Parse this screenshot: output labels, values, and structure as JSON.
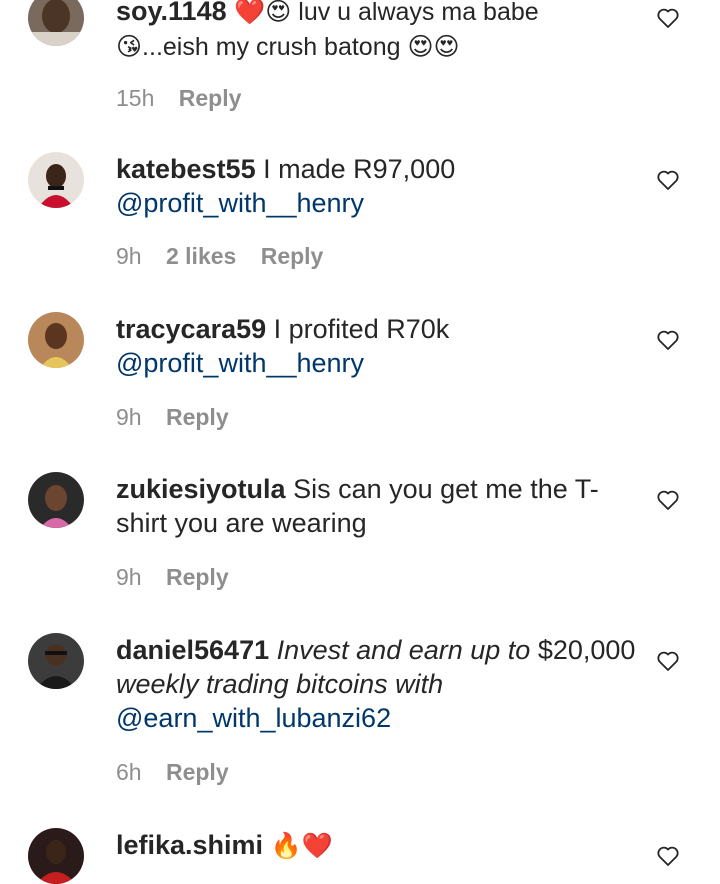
{
  "comments": [
    {
      "username": "soy.1148",
      "text_parts": [
        "❤️😍 luv u always ma babe",
        "😘...eish my crush batong 😍😍"
      ],
      "time": "15h",
      "likes": "",
      "reply": "Reply"
    },
    {
      "username": "katebest55",
      "text": "I made R97,000",
      "mention": "@profit_with__henry",
      "time": "9h",
      "likes": "2 likes",
      "reply": "Reply"
    },
    {
      "username": "tracycara59",
      "text": "I profited R70k",
      "mention": "@profit_with__henry",
      "time": "9h",
      "likes": "",
      "reply": "Reply"
    },
    {
      "username": "zukiesiyotula",
      "text": "Sis can you get me the T-shirt you are wearing",
      "time": "9h",
      "likes": "",
      "reply": "Reply"
    },
    {
      "username": "daniel56471",
      "text_italic": "Invest and earn up to",
      "text_amount": "$20,000",
      "text_italic2": "weekly trading bitcoins with",
      "mention": "@earn_with_lubanzi62",
      "time": "6h",
      "likes": "",
      "reply": "Reply"
    },
    {
      "username": "lefika.shimi",
      "text": "🔥❤️"
    }
  ],
  "icons": {
    "like": "heart-outline-icon"
  },
  "colors": {
    "text": "#262626",
    "meta": "#8e8e8e",
    "mention": "#00376b"
  }
}
